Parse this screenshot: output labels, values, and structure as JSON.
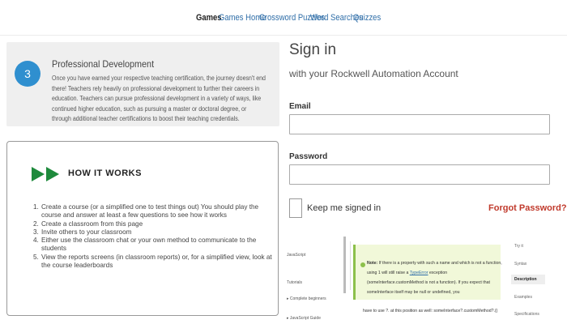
{
  "nav": {
    "items": [
      {
        "label": "Games",
        "active": true
      },
      {
        "label": "Games Home",
        "active": false
      },
      {
        "label": "Crossword Puzzles",
        "active": false
      },
      {
        "label": "Word Searches",
        "active": false
      },
      {
        "label": "Quizzes",
        "active": false
      }
    ]
  },
  "professional_development": {
    "step_number": "3",
    "title": "Professional Development",
    "body": "Once you have earned your respective teaching certification, the journey doesn't end there! Teachers rely heavily on professional development to further their careers in education. Teachers can pursue professional development in a variety of ways, like continued higher education, such as pursuing a master or doctoral degree, or through additional teacher certifications to boost their teaching credentials."
  },
  "how_it_works": {
    "title": "HOW IT WORKS",
    "accent_color": "#1e8a3c",
    "steps": [
      {
        "num": "1.",
        "text": "Create a course (or a simplified one to test things out)   You should play the course and answer at least a few questions to see how it works"
      },
      {
        "num": "2.",
        "text": "Create a classroom from this page"
      },
      {
        "num": "3.",
        "text": "Invite others to your classroom"
      },
      {
        "num": "4.",
        "text": "Either use the classroom chat or your own method to communicate to the students"
      },
      {
        "num": "5.",
        "text": "View the reports screens (in classroom reports) or, for a simplified view, look at the course leaderboards"
      }
    ]
  },
  "signin": {
    "title": "Sign in",
    "subtitle": "with your Rockwell Automation Account",
    "email_label": "Email",
    "email_value": "",
    "password_label": "Password",
    "password_value": "",
    "keep_signed_in_label": "Keep me signed in",
    "keep_signed_in_checked": false,
    "forgot_password_label": "Forgot Password?",
    "forgot_color": "#c0392b"
  },
  "doc_snippet": {
    "left_nav": [
      "JavaScript",
      "Tutorials",
      "Complete beginners",
      "JavaScript Guide"
    ],
    "note_label": "Note:",
    "note_line1": "If there is a property with such a name and which is not a function, using",
    "note_code1": "1",
    "note_line2": "will still raise a",
    "note_code2": "TypeError",
    "note_line3": "exception (someInterface.customMethod is not a function). If you expect that someInterface itself may be null or undefined, you",
    "after_note": "have to use ?. at this position as well: someInterface?.customMethod?.()",
    "right_nav": [
      "Try it",
      "Syntax",
      "Description",
      "Examples",
      "Specifications"
    ],
    "right_nav_active": "Description"
  }
}
